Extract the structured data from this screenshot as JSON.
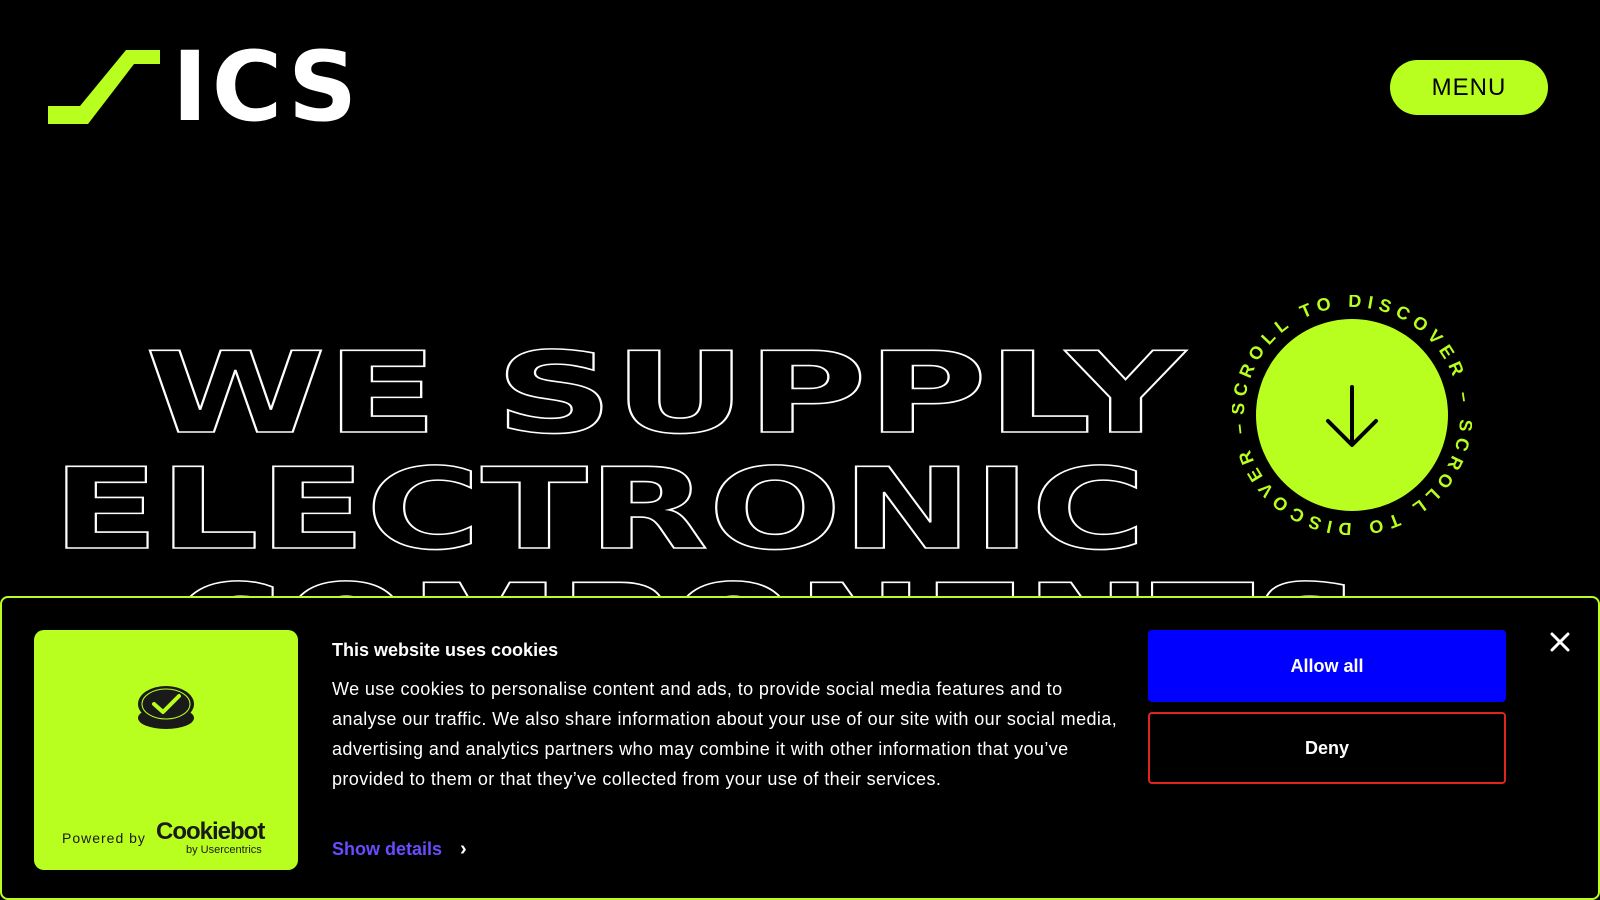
{
  "header": {
    "logo_text": "ICS",
    "menu_label": "MENU"
  },
  "hero": {
    "lines": [
      "WE SUPPLY",
      "ELECTRONIC",
      "COMPONENTS"
    ]
  },
  "scroll_badge": {
    "ring_text": "SCROLL TO DISCOVER – SCROLL TO DISCOVER – "
  },
  "cookie_banner": {
    "powered_by": "Powered by",
    "brand": "Cookiebot",
    "brand_sub": "by Usercentrics",
    "title": "This website uses cookies",
    "body": "We use cookies to personalise content and ads, to provide social media features and to analyse our traffic. We also share information about your use of our site with our social media, advertising and analytics partners who may combine it with other information that you’ve provided to them or that they’ve collected from your use of their services.",
    "show_details": "Show details",
    "allow_all": "Allow all",
    "deny": "Deny"
  },
  "colors": {
    "accent": "#B8FF1F",
    "background": "#000000",
    "allow_button": "#0000FF",
    "deny_border": "#E0261C",
    "link": "#6B4BFF"
  },
  "icons": {
    "menu": "none",
    "scroll": "arrow-down-icon",
    "close": "close-icon",
    "cookiebot": "cookiebot-shield-icon",
    "show_details": "chevron-right-icon"
  }
}
